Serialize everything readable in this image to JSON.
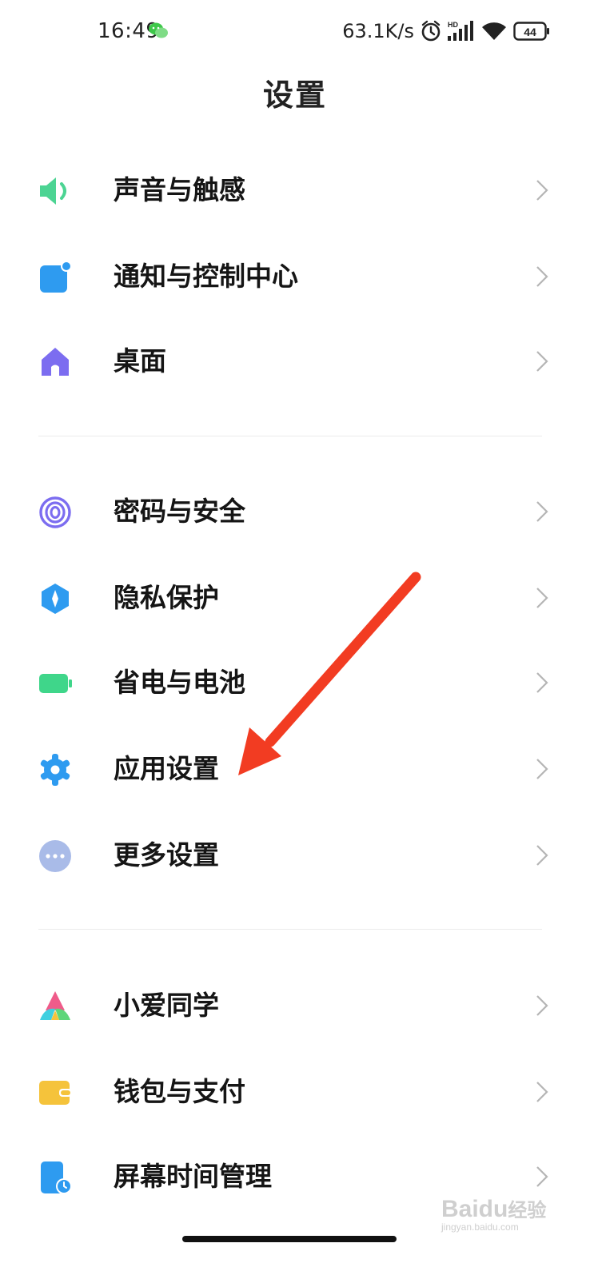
{
  "status_bar": {
    "time": "16:49",
    "network_speed": "63.1K/s",
    "network_type": "HD",
    "battery_level": "44",
    "icons": [
      "wechat-icon",
      "alarm-icon",
      "signal-icon",
      "wifi-icon",
      "battery-icon"
    ]
  },
  "page": {
    "title": "设置"
  },
  "groups": [
    {
      "items": [
        {
          "label": "声音与触感",
          "icon": "speaker-icon",
          "color": "#4cd493"
        },
        {
          "label": "通知与控制中心",
          "icon": "notification-icon",
          "color": "#2e9bf0"
        },
        {
          "label": "桌面",
          "icon": "home-icon",
          "color": "#7c6df0"
        }
      ]
    },
    {
      "items": [
        {
          "label": "密码与安全",
          "icon": "fingerprint-icon",
          "color": "#7c6df0"
        },
        {
          "label": "隐私保护",
          "icon": "privacy-shield-icon",
          "color": "#2e9bf0"
        },
        {
          "label": "省电与电池",
          "icon": "battery-icon",
          "color": "#3fd68a"
        },
        {
          "label": "应用设置",
          "icon": "gear-icon",
          "color": "#2e9bf0"
        },
        {
          "label": "更多设置",
          "icon": "more-dots-icon",
          "color": "#a9bbe8"
        }
      ]
    },
    {
      "items": [
        {
          "label": "小爱同学",
          "icon": "xiaoai-icon",
          "color": "#ef5b8a"
        },
        {
          "label": "钱包与支付",
          "icon": "wallet-icon",
          "color": "#f5c33b"
        },
        {
          "label": "屏幕时间管理",
          "icon": "screen-time-icon",
          "color": "#2e9bf0"
        }
      ]
    }
  ],
  "annotation": {
    "color": "#f23c22"
  },
  "watermark": {
    "brand": "Baidu",
    "brand_cn": "经验",
    "site": "jingyan.baidu.com"
  }
}
